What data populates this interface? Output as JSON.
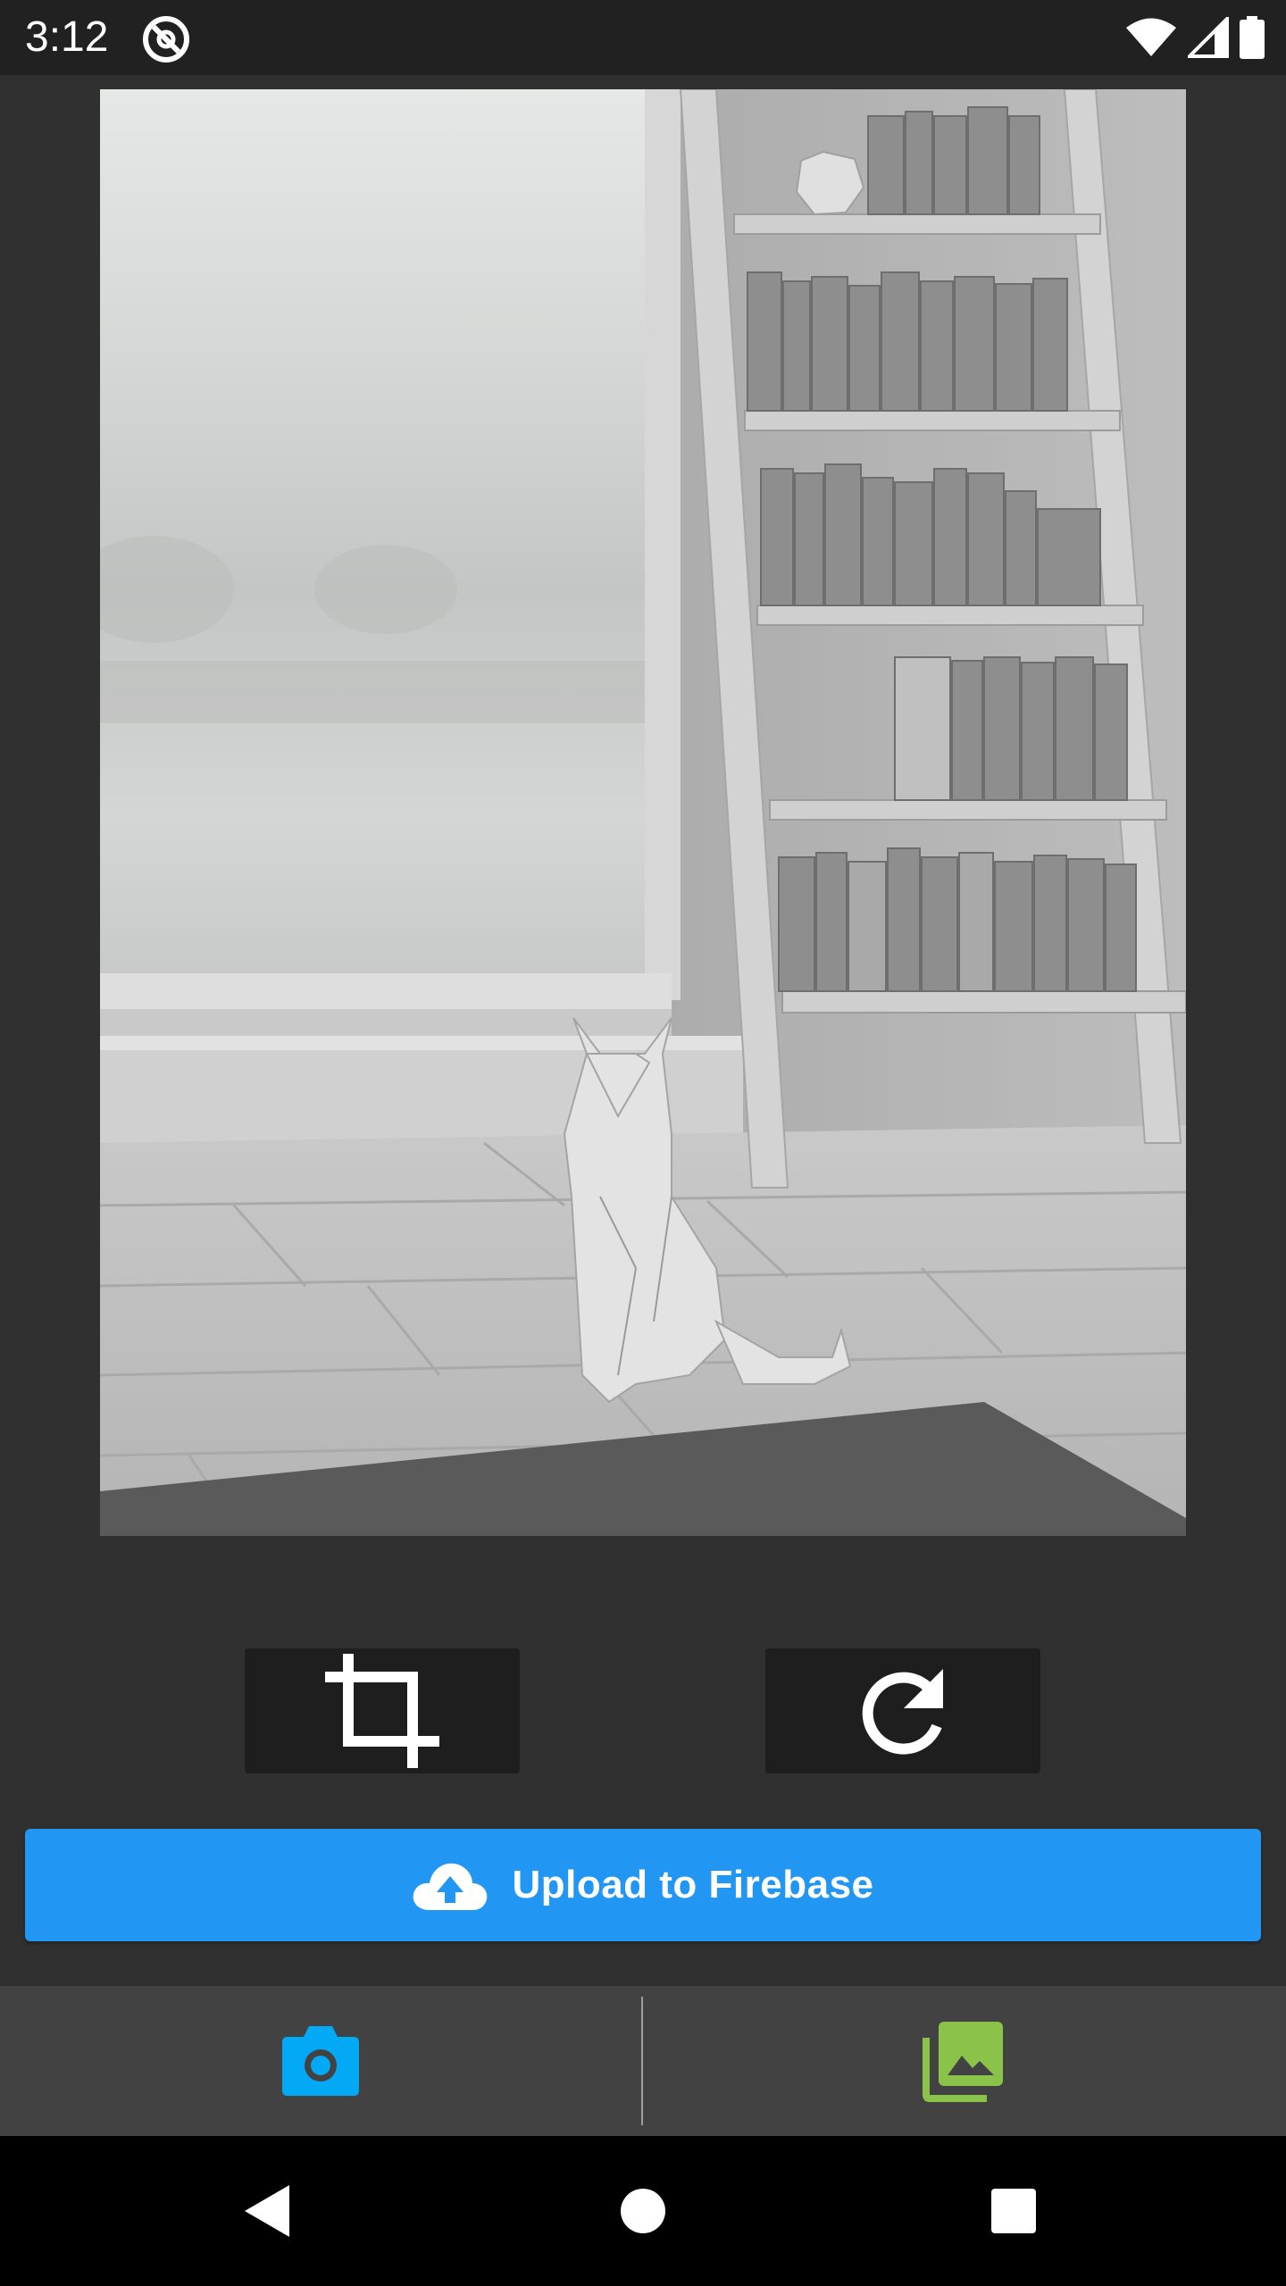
{
  "status_bar": {
    "time": "3:12",
    "icons": [
      "at-sign-icon",
      "wifi-icon",
      "cellular-signal-icon",
      "battery-icon"
    ]
  },
  "preview": {
    "icon": "photo-preview"
  },
  "toolbar": {
    "crop_icon": "crop-icon",
    "rotate_icon": "rotate-icon"
  },
  "upload": {
    "label": "Upload to Firebase",
    "icon": "cloud-upload-icon",
    "color": "#2196f3"
  },
  "bottom_bar": {
    "camera_icon": "camera-icon",
    "camera_color": "#03a9f4",
    "gallery_icon": "photo-library-icon",
    "gallery_color": "#8bc34a"
  },
  "nav_bar": {
    "icons": [
      "back-icon",
      "home-icon",
      "recents-icon"
    ]
  }
}
